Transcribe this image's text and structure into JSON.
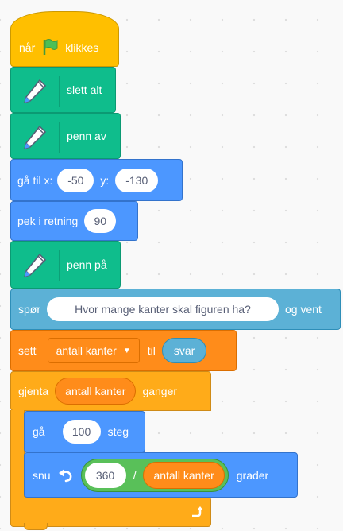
{
  "blocks": {
    "when_flag": {
      "before": "når",
      "after": "klikkes"
    },
    "clear": {
      "label": "slett alt"
    },
    "pen_up": {
      "label": "penn av"
    },
    "goto": {
      "label": "gå til x:",
      "x": "-50",
      "y_label": "y:",
      "y": "-130"
    },
    "point": {
      "label": "pek i retning",
      "value": "90"
    },
    "pen_down": {
      "label": "penn på"
    },
    "ask": {
      "label": "spør",
      "question": "Hvor mange kanter skal figuren ha?",
      "suffix": "og vent"
    },
    "set_var": {
      "label": "sett",
      "variable": "antall kanter",
      "to": "til",
      "value": "svar"
    },
    "repeat": {
      "label": "gjenta",
      "times": "antall kanter",
      "suffix": "ganger"
    },
    "move": {
      "label": "gå",
      "value": "100",
      "suffix": "steg"
    },
    "turn": {
      "label": "snu",
      "numerator": "360",
      "operator": "/",
      "denominator": "antall kanter",
      "suffix": "grader"
    }
  },
  "colors": {
    "events": "#ffbf00",
    "pen": "#0fbd8c",
    "motion": "#4c97ff",
    "sensing": "#5cb1d6",
    "variables": "#ff8c1a",
    "control": "#ffab19",
    "operators": "#59c059"
  },
  "icons": [
    "green-flag-icon",
    "pen-icon",
    "dropdown-arrow-icon",
    "turn-left-icon",
    "loop-arrow-icon"
  ]
}
